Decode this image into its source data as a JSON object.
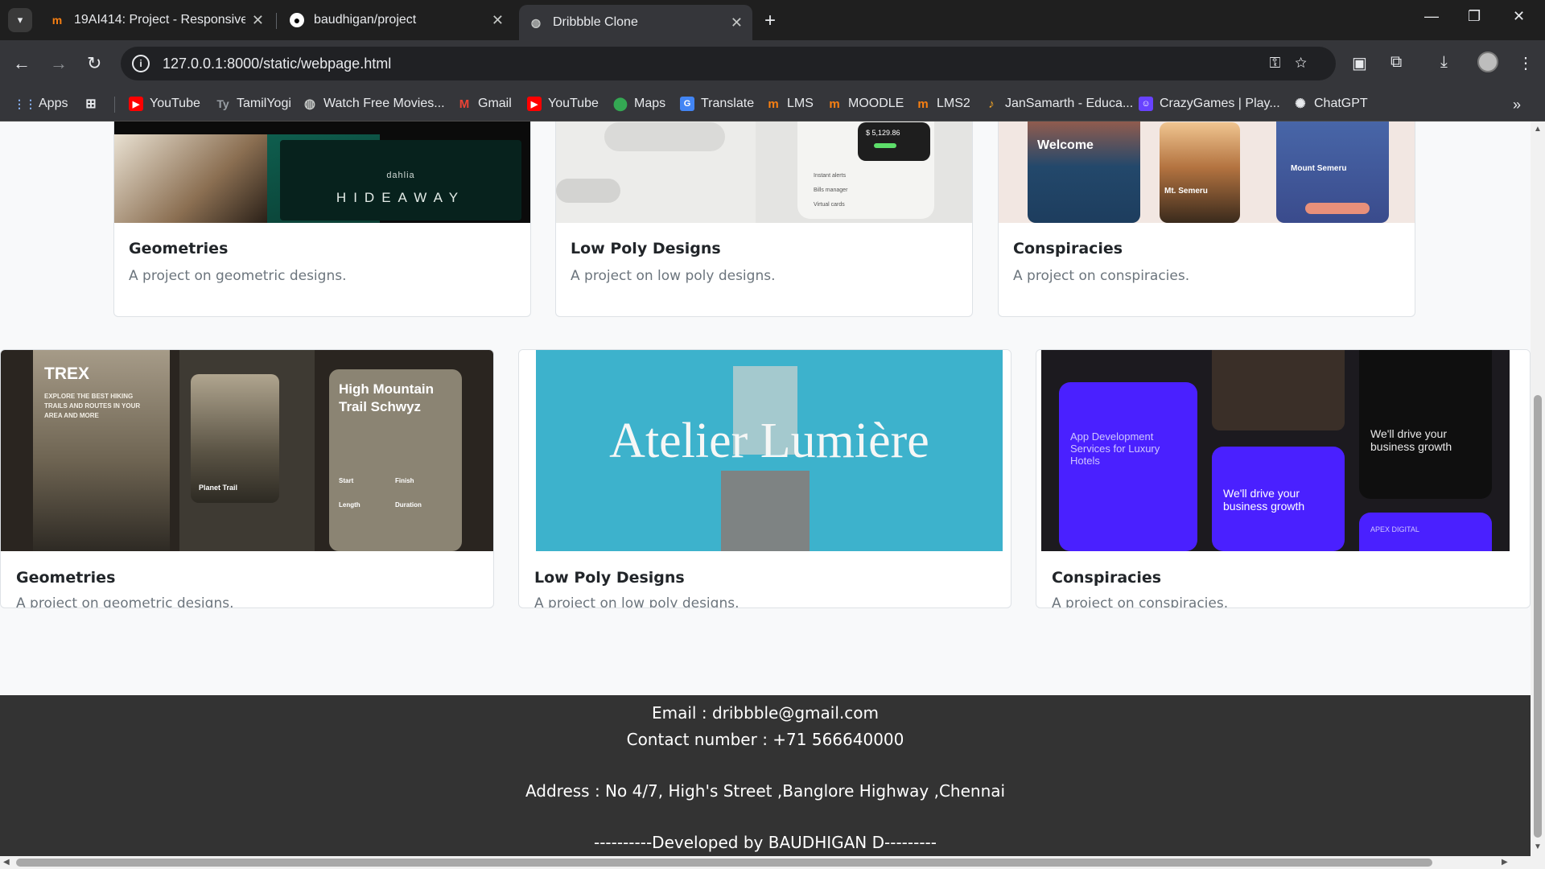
{
  "browser": {
    "tabs": [
      {
        "title": "19AI414: Project - Responsive W",
        "favicon": "moodle-icon",
        "active": false
      },
      {
        "title": "baudhigan/project",
        "favicon": "github-icon",
        "active": false
      },
      {
        "title": "Dribbble Clone",
        "favicon": "globe-icon",
        "active": true
      }
    ],
    "url": "127.0.0.1:8000/static/webpage.html",
    "bookmarks": [
      {
        "label": "Apps",
        "icon": "apps-grid-icon"
      },
      {
        "label": "",
        "icon": "tab-groups-icon"
      },
      {
        "label": "YouTube",
        "icon": "youtube-icon"
      },
      {
        "label": "TamilYogi",
        "icon": "tamilyogi-icon"
      },
      {
        "label": "Watch Free Movies...",
        "icon": "globe-icon"
      },
      {
        "label": "Gmail",
        "icon": "gmail-icon"
      },
      {
        "label": "YouTube",
        "icon": "youtube-icon"
      },
      {
        "label": "Maps",
        "icon": "maps-icon"
      },
      {
        "label": "Translate",
        "icon": "translate-icon"
      },
      {
        "label": "LMS",
        "icon": "moodle-icon"
      },
      {
        "label": "MOODLE",
        "icon": "moodle-icon"
      },
      {
        "label": "LMS2",
        "icon": "moodle-icon"
      },
      {
        "label": "JanSamarth - Educa...",
        "icon": "jansamarth-icon"
      },
      {
        "label": "CrazyGames | Play...",
        "icon": "crazygames-icon"
      },
      {
        "label": "ChatGPT",
        "icon": "chatgpt-icon"
      }
    ],
    "colors": {
      "tabstrip": "#1f1f1f",
      "toolbar": "#35363a",
      "omnibox": "#202124"
    }
  },
  "cards_row1": [
    {
      "title": "Geometries",
      "desc": "A project on geometric designs.",
      "image_text": [
        "dahlia",
        "HIDEAWAY"
      ]
    },
    {
      "title": "Low Poly Designs",
      "desc": "A project on low poly designs.",
      "image_text": [
        "$ 5,129.86",
        "Instant alerts",
        "Bills manager",
        "Virtual cards"
      ]
    },
    {
      "title": "Conspiracies",
      "desc": "A project on conspiracies.",
      "image_text": [
        "Welcome",
        "Mt. Semeru",
        "Mount Semeru"
      ]
    }
  ],
  "cards_row2": [
    {
      "title": "Geometries",
      "desc": "A project on geometric designs.",
      "image_text": [
        "TREX",
        "EXPLORE THE BEST HIKING TRAILS AND ROUTES IN YOUR AREA AND MORE",
        "High Mountain Trail Schwyz",
        "Planet Trail",
        "Start",
        "Finish",
        "Length",
        "Duration"
      ]
    },
    {
      "title": "Low Poly Designs",
      "desc": "A project on low poly designs.",
      "image_text": [
        "Atelier Lumière"
      ]
    },
    {
      "title": "Conspiracies",
      "desc": "A project on conspiracies.",
      "image_text": [
        "App Development Services for Luxury Hotels",
        "We'll drive your business growth",
        "APEX DIGITAL"
      ]
    }
  ],
  "footer": {
    "email": "Email : dribbble@gmail.com",
    "contact": "Contact number : +71 566640000",
    "address": "Address : No 4/7, High's Street ,Banglore Highway ,Chennai",
    "credit": "----------Developed by BAUDHIGAN D---------",
    "bg": "#333333"
  }
}
